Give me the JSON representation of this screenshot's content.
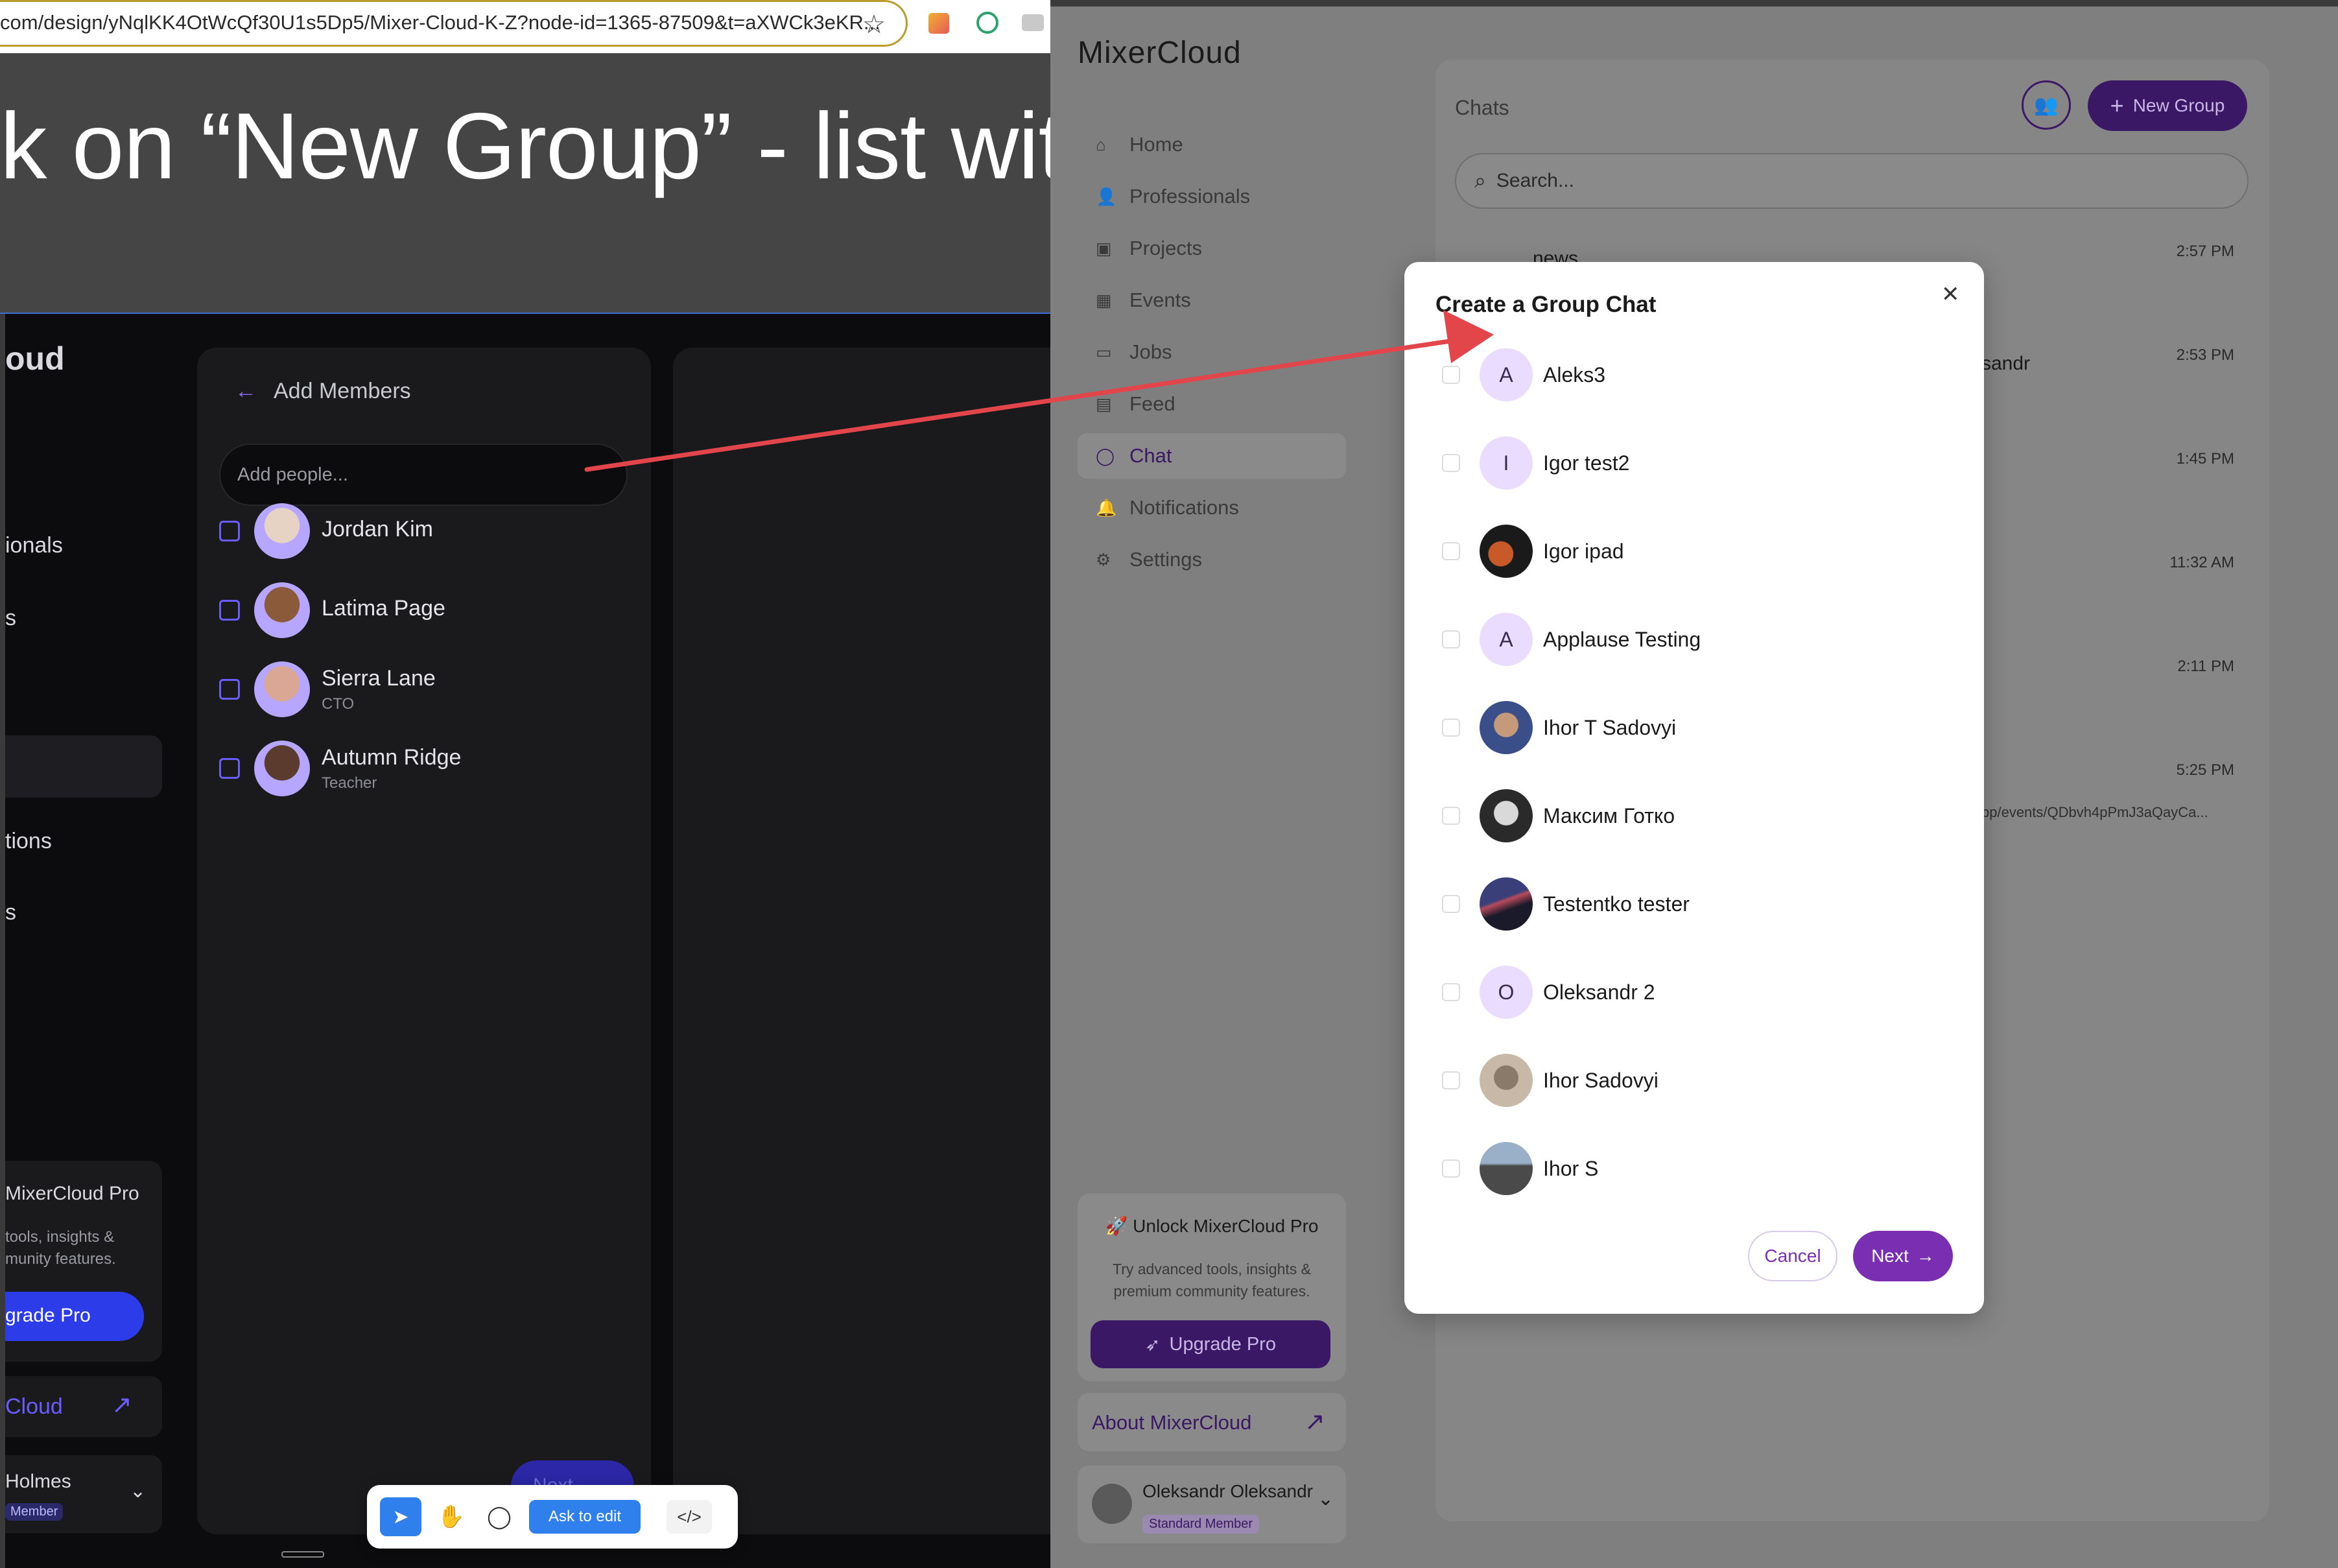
{
  "browser": {
    "url": "com/design/yNqlKK4OtWcQf30U1s5Dp5/Mixer-Cloud-K-Z?node-id=1365-87509&t=aXWCk3eKR..."
  },
  "canvas": {
    "heading": "k on “New Group” - list with"
  },
  "dark_app": {
    "brand_partial": "oud",
    "sidebar_partials": [
      "ionals",
      "s",
      "tions",
      "s"
    ],
    "add_members_title": "Add Members",
    "add_people_placeholder": "Add people...",
    "members": [
      {
        "name": "Jordan Kim",
        "role": ""
      },
      {
        "name": "Latima Page",
        "role": ""
      },
      {
        "name": "Sierra Lane",
        "role": "CTO"
      },
      {
        "name": "Autumn Ridge",
        "role": "Teacher"
      }
    ],
    "pro_title": "MixerCloud Pro",
    "pro_desc_1": "tools, insights &",
    "pro_desc_2": "munity features.",
    "upgrade_partial": "grade Pro",
    "about_partial": "Cloud",
    "user_partial": "Holmes",
    "member_partial": "Member",
    "next_partial": "Next"
  },
  "toolbar": {
    "ask_to_edit": "Ask to edit"
  },
  "light_app": {
    "brand": "MixerCloud",
    "nav": [
      {
        "label": "Home",
        "icon": "home-icon"
      },
      {
        "label": "Professionals",
        "icon": "users-icon"
      },
      {
        "label": "Projects",
        "icon": "briefcase-icon"
      },
      {
        "label": "Events",
        "icon": "calendar-icon"
      },
      {
        "label": "Jobs",
        "icon": "bag-icon"
      },
      {
        "label": "Feed",
        "icon": "feed-icon"
      },
      {
        "label": "Chat",
        "icon": "chat-icon"
      },
      {
        "label": "Notifications",
        "icon": "bell-icon"
      },
      {
        "label": "Settings",
        "icon": "gear-icon"
      }
    ],
    "active_nav": "Chat",
    "chats_title": "Chats",
    "new_group": "New Group",
    "search_placeholder": "Search...",
    "chat_times": [
      "2:57 PM",
      "2:53 PM",
      "1:45 PM",
      "11:32 AM",
      "2:11 PM",
      "5:25 PM"
    ],
    "chat_partial_name_1": "news",
    "chat_partial_name_2": "sandr",
    "chat_partial_preview": "pp/events/QDbvh4pPmJ3aQayCa...",
    "pro_title": "🚀 Unlock MixerCloud Pro",
    "pro_desc": "Try advanced tools, insights & premium community features.",
    "upgrade_label": "Upgrade Pro",
    "about_label": "About MixerCloud",
    "user_name": "Oleksandr Oleksandr",
    "user_badge": "Standard Member"
  },
  "modal": {
    "title": "Create a Group Chat",
    "members": [
      {
        "name": "Aleks3",
        "initial": "A"
      },
      {
        "name": "Igor test2",
        "initial": "I"
      },
      {
        "name": "Igor ipad",
        "initial": ""
      },
      {
        "name": "Applause Testing",
        "initial": "A"
      },
      {
        "name": "Ihor T Sadovyi",
        "initial": ""
      },
      {
        "name": "Максим Готко",
        "initial": ""
      },
      {
        "name": "Testentko tester",
        "initial": ""
      },
      {
        "name": "Oleksandr 2",
        "initial": "O"
      },
      {
        "name": "Ihor Sadovyi",
        "initial": ""
      },
      {
        "name": "Ihor S",
        "initial": ""
      }
    ],
    "cancel_label": "Cancel",
    "next_label": "Next"
  },
  "colors": {
    "brand_purple": "#7a2fb3",
    "arrow_red": "#e2454a",
    "dark_bg": "#0c0c0e",
    "accent_blue": "#2b3ce8"
  }
}
